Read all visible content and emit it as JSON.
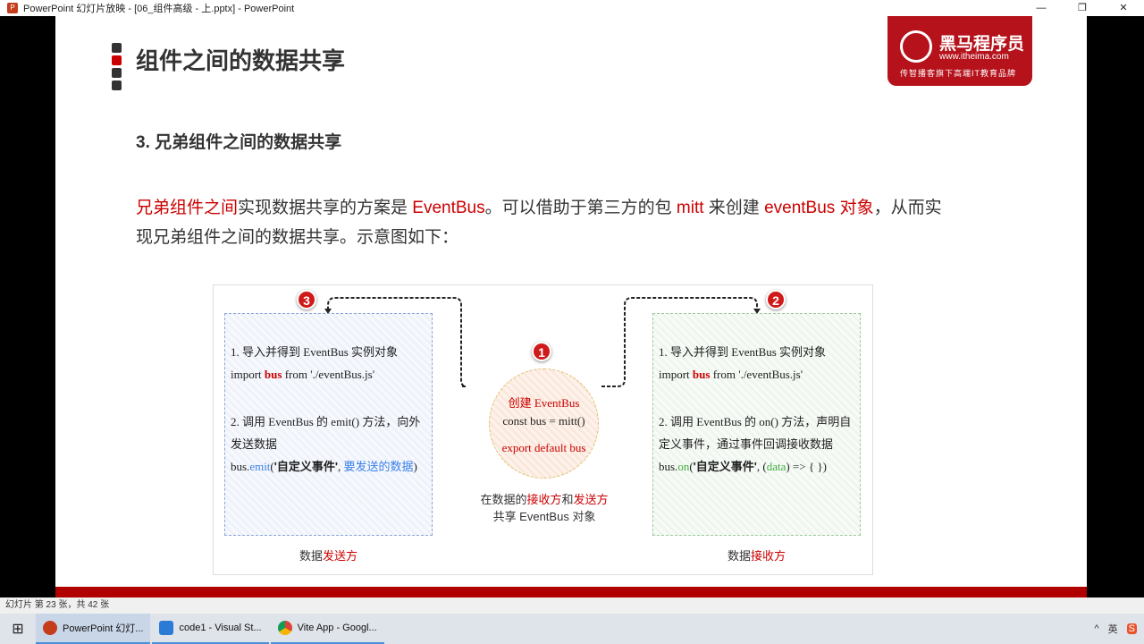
{
  "window": {
    "title": "PowerPoint 幻灯片放映 - [06_组件高级 - 上.pptx] - PowerPoint",
    "controls": [
      "—",
      "❐",
      "✕"
    ]
  },
  "slide": {
    "title": "组件之间的数据共享",
    "logo": {
      "name": "黑马程序员",
      "url": "www.itheima.com",
      "slogan": "传智播客旗下高端IT教育品牌"
    },
    "subtitle": "3. 兄弟组件之间的数据共享",
    "paragraph": {
      "p1": "兄弟组件之间",
      "p2": "实现数据共享的方案是 ",
      "p3": "EventBus",
      "p4": "。可以借助于第三方的包 ",
      "p5": "mitt",
      "p6": " 来创建 ",
      "p7": "eventBus 对象",
      "p8": "，从而实现兄弟组件之间的数据共享。示意图如下："
    },
    "diagram": {
      "sender": {
        "badge": "3",
        "line1": "1. 导入并得到 EventBus 实例对象",
        "import_a": "import ",
        "import_b": "bus",
        "import_c": " from './eventBus.js'",
        "line2": "2. 调用 EventBus 的 emit() 方法，向外发送数据",
        "code_a": "bus.",
        "code_b": "emit",
        "code_c": "(",
        "code_d": "'自定义事件'",
        "code_e": ", ",
        "code_f": "要发送的数据",
        "code_g": ")",
        "caption_a": "数据",
        "caption_b": "发送方"
      },
      "receiver": {
        "badge": "2",
        "line1": "1. 导入并得到 EventBus 实例对象",
        "import_a": "import ",
        "import_b": "bus",
        "import_c": " from './eventBus.js'",
        "line2": "2. 调用 EventBus 的 on() 方法，声明自定义事件，通过事件回调接收数据",
        "code_a": "bus.",
        "code_b": "on",
        "code_c": "(",
        "code_d": "'自定义事件'",
        "code_e": ", (",
        "code_f": "data",
        "code_g": ") => { })",
        "caption_a": "数据",
        "caption_b": "接收方"
      },
      "center": {
        "badge": "1",
        "line1": "创建 EventBus",
        "line2": "const bus = mitt()",
        "line3": "export default bus",
        "caption_a": "在数据的",
        "caption_b": "接收方",
        "caption_c": "和",
        "caption_d": "发送方",
        "caption_e": "共享 EventBus 对象"
      }
    }
  },
  "status": {
    "slide_info": "幻灯片 第 23 张，共 42 张"
  },
  "taskbar": {
    "items": [
      {
        "label": "PowerPoint 幻灯...",
        "color": "#c43e1c"
      },
      {
        "label": "code1 - Visual St...",
        "color": "#2b7bd6"
      },
      {
        "label": "Vite App - Googl...",
        "color": "#e8b417"
      }
    ],
    "tray": [
      "^",
      "英",
      "S"
    ]
  }
}
